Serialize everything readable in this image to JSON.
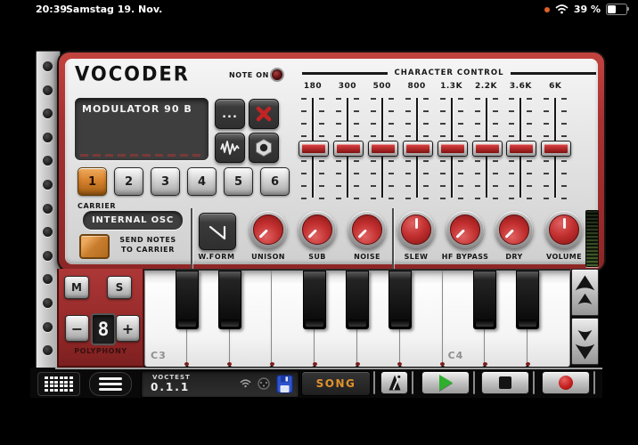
{
  "colors": {
    "panel_red": "#a83232",
    "panel_silver": "#e6e6e6",
    "display_dark": "#3f3e3e",
    "accent_orange": "#d8832f",
    "knob_red": "#c22f2f",
    "song_text_orange": "#e2922d",
    "led_meter_green": "#46602f"
  },
  "status_bar": {
    "time": "20:39",
    "date": "Samstag 19. Nov.",
    "battery_text": "39 %",
    "icons": [
      "orange-record-dot",
      "wifi-icon",
      "battery-icon"
    ]
  },
  "vocoder": {
    "title": "VOCODER",
    "note_on": "NOTE ON",
    "display_text": "MODULATOR 90 B",
    "menu_dots": "...",
    "presets": [
      "1",
      "2",
      "3",
      "4",
      "5",
      "6"
    ],
    "active_preset_index": 0,
    "carrier_label": "CARRIER",
    "carrier_source": "INTERNAL OSC",
    "send_notes_line1": "SEND NOTES",
    "send_notes_line2": "TO CARRIER",
    "wform_label": "W.FORM",
    "character_control_title": "CHARACTER CONTROL",
    "bands": [
      {
        "label": "180",
        "value": 50
      },
      {
        "label": "300",
        "value": 50
      },
      {
        "label": "500",
        "value": 50
      },
      {
        "label": "800",
        "value": 50
      },
      {
        "label": "1.3K",
        "value": 50
      },
      {
        "label": "2.2K",
        "value": 50
      },
      {
        "label": "3.6K",
        "value": 50
      },
      {
        "label": "6K",
        "value": 50
      }
    ],
    "knobs": [
      {
        "label": "UNISON",
        "angle": -135
      },
      {
        "label": "SUB",
        "angle": -135
      },
      {
        "label": "NOISE",
        "angle": -135
      },
      {
        "label": "SLEW",
        "angle": 0
      },
      {
        "label": "HF BYPASS",
        "angle": -135
      },
      {
        "label": "DRY",
        "angle": -135
      },
      {
        "label": "VOLUME",
        "angle": 0
      }
    ],
    "icons": {
      "note_on_led": "dark-red-led",
      "close": "red-x",
      "waveform_button": "squiggle-wave",
      "hex_button": "hex-nut",
      "wform_button": "saw-wave"
    }
  },
  "left_controls": {
    "mute": "M",
    "solo": "S",
    "minus": "−",
    "plus": "+",
    "polyphony_value": "8",
    "polyphony_label": "POLYPHONY"
  },
  "keyboard": {
    "white_key_labels": [
      "C3",
      "",
      "",
      "",
      "",
      "",
      "",
      "C4",
      "",
      ""
    ],
    "black_key_after": [
      0,
      1,
      3,
      4,
      5,
      7,
      8
    ],
    "octave_icons": [
      "double-up-arrow",
      "double-down-arrow"
    ]
  },
  "toolbar": {
    "patch_name": "VOCTEST",
    "version": "0.1.1",
    "song_label": "SONG",
    "icons": [
      "pad-grid",
      "hamburger-menu",
      "wifi",
      "midi-din",
      "floppy-save",
      "metronome",
      "play-triangle",
      "stop-square",
      "record-circle"
    ]
  }
}
